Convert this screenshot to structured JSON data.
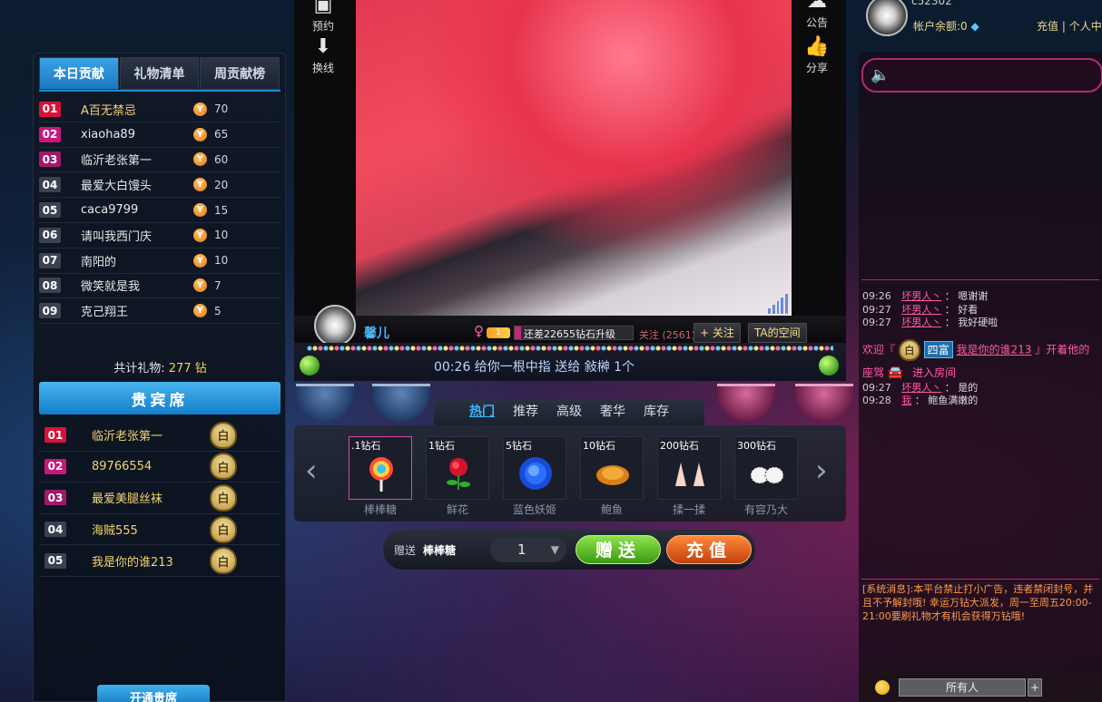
{
  "left_panel": {
    "tabs": [
      "本日贡献",
      "礼物清单",
      "周贡献榜"
    ],
    "ranking": [
      {
        "rank": "01",
        "name": "A百无禁忌",
        "value": "70",
        "color": "#d8123c"
      },
      {
        "rank": "02",
        "name": "xiaoha89",
        "value": "65",
        "color": "#c8187c"
      },
      {
        "rank": "03",
        "name": "临沂老张第一",
        "value": "60",
        "color": "#a11a6a"
      },
      {
        "rank": "04",
        "name": "最爱大白馒头",
        "value": "20",
        "color": "#3a4252"
      },
      {
        "rank": "05",
        "name": "caca9799",
        "value": "15",
        "color": "#3a4252"
      },
      {
        "rank": "06",
        "name": "请叫我西门庆",
        "value": "10",
        "color": "#3a4252"
      },
      {
        "rank": "07",
        "name": "南阳的",
        "value": "10",
        "color": "#3a4252"
      },
      {
        "rank": "08",
        "name": "微笑就是我",
        "value": "7",
        "color": "#3a4252"
      },
      {
        "rank": "09",
        "name": "克己翔王",
        "value": "5",
        "color": "#3a4252"
      }
    ],
    "coin_glyph": "Y",
    "total_label": "共计礼物:",
    "total_value": "277 钻",
    "vip_title": "贵宾席",
    "vip_list": [
      {
        "rank": "01",
        "name": "临沂老张第一",
        "badge": "白",
        "color": "#d8123c"
      },
      {
        "rank": "02",
        "name": "89766554",
        "badge": "白",
        "color": "#c8187c"
      },
      {
        "rank": "03",
        "name": "最爱美腿丝袜",
        "badge": "白",
        "color": "#a11a6a"
      },
      {
        "rank": "04",
        "name": "海贼555",
        "badge": "白",
        "color": "#3a4252"
      },
      {
        "rank": "05",
        "name": "我是你的谁213",
        "badge": "白",
        "color": "#3a4252"
      }
    ],
    "open_vip_label": "开通贵席"
  },
  "video": {
    "tools_left": [
      {
        "label": "预约",
        "icon": "calendar-icon",
        "glyph": "▣"
      },
      {
        "label": "换线",
        "icon": "download-arrow-icon",
        "glyph": "⬇"
      }
    ],
    "tools_right": [
      {
        "label": "公告",
        "icon": "speech-bubble-icon",
        "glyph": "☁"
      },
      {
        "label": "分享",
        "icon": "thumbs-up-icon",
        "glyph": "👍"
      }
    ],
    "anchor_name": "馨儿",
    "gender_glyph": "♀",
    "level": "1",
    "upgrade_text": "还差22655钻石升级",
    "upgrade_progress": 0.05,
    "follow_count": "关注 (2561)",
    "follow_button": "+ 关注",
    "space_button": "TA的空间",
    "marquee_text": "00:26  给你一根中指 送给 敍榊   1个"
  },
  "gifts": {
    "tabs": [
      "热门",
      "推荐",
      "高级",
      "奢华",
      "库存"
    ],
    "active_tab": 0,
    "items": [
      {
        "price": ".1钻石",
        "name": "棒棒糖",
        "icon": "lollipop-icon",
        "selected": true
      },
      {
        "price": "1钻石",
        "name": "鲜花",
        "icon": "rose-icon",
        "selected": false
      },
      {
        "price": "5钻石",
        "name": "蓝色妖姬",
        "icon": "blue-rose-icon",
        "selected": false
      },
      {
        "price": "10钻石",
        "name": "鲍鱼",
        "icon": "abalone-icon",
        "selected": false
      },
      {
        "price": "200钻石",
        "name": "揉一揉",
        "icon": "hands-icon",
        "selected": false
      },
      {
        "price": "300钻石",
        "name": "有容乃大",
        "icon": "bra-icon",
        "selected": false
      }
    ],
    "send_label": "赠送",
    "send_gift_name": "棒棒糖",
    "quantity": "1",
    "send_button": "赠送",
    "recharge_button": "充值"
  },
  "right": {
    "username": "c52302",
    "balance_label": "帐户余额:0",
    "recharge_link": "充值",
    "separator": "|",
    "personal_center": "个人中心",
    "chat": [
      {
        "time": "09:26",
        "user": "坏男人丶",
        "text": "嗯谢谢"
      },
      {
        "time": "09:27",
        "user": "坏男人丶",
        "text": "好看"
      },
      {
        "time": "09:27",
        "user": "坏男人丶",
        "text": "我好硬啦"
      }
    ],
    "welcome_prefix": "欢迎『",
    "welcome_badge": "白",
    "welcome_rich": "四富",
    "welcome_user": "我是你的谁213",
    "welcome_suffix": "』开着他的",
    "welcome_car": "座驾",
    "welcome_enter": "进入房间",
    "chat_after": [
      {
        "time": "09:27",
        "user": "坏男人丶",
        "text": "是的"
      },
      {
        "time": "09:28",
        "user": "我",
        "text": "鲍鱼满嫩的"
      }
    ],
    "system_message": "[系统消息]:本平台禁止打小广告，违者禁闭封号，并且不予解封哦! 幸运万钻大派发，周一至周五20:00-21:00要刷礼物才有机会获得万钻哦!",
    "to_select": "所有人",
    "to_plus": "+"
  }
}
